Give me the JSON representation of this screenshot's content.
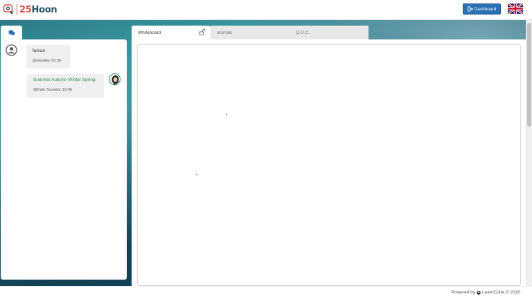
{
  "header": {
    "logo": {
      "number": "25",
      "word": "Hoon"
    },
    "dashboard_label": "Dashboard",
    "language_flag": "uk-flag-icon"
  },
  "chat": {
    "tab_icon": "chat-bubbles-icon",
    "messages": [
      {
        "text": "faman",
        "author_time": "@westley 19:35",
        "avatar": "user-icon",
        "side": "left"
      },
      {
        "text": "Summer Autumn Winter Spring",
        "author_time": "@Kate Sarador 19:45",
        "avatar": "profile-photo",
        "side": "right",
        "text_color": "#2e8b57"
      }
    ]
  },
  "tabs": [
    {
      "label": "Whiteboard",
      "active": true,
      "icon": "unlock-icon"
    },
    {
      "label": "animals",
      "active": false
    },
    {
      "label": "Q.O.C.",
      "active": false
    }
  ],
  "footer": {
    "powered_prefix": "Powered by",
    "powered_brand": "LearnCube © 2020"
  },
  "colors": {
    "accent": "#2a6fb0",
    "logo_red": "#d9534f",
    "logo_teal": "#2c5560",
    "highlight_text": "#2e8b57"
  }
}
